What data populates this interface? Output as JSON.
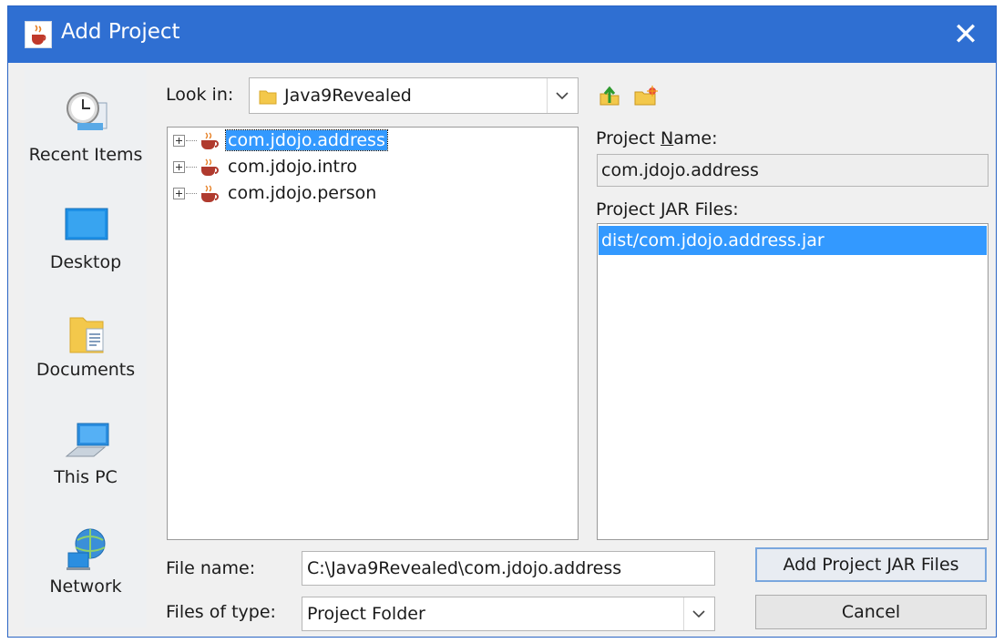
{
  "window": {
    "title": "Add Project",
    "close_glyph": "✕"
  },
  "places": [
    {
      "label": "Recent Items",
      "icon": "clock-icon"
    },
    {
      "label": "Desktop",
      "icon": "desktop-icon"
    },
    {
      "label": "Documents",
      "icon": "documents-folder-icon"
    },
    {
      "label": "This PC",
      "icon": "computer-icon"
    },
    {
      "label": "Network",
      "icon": "network-icon"
    }
  ],
  "look_in": {
    "label": "Look in:",
    "value": "Java9Revealed"
  },
  "toolbar": {
    "up_icon": "up-folder-icon",
    "new_folder_icon": "new-folder-icon"
  },
  "file_list": {
    "items": [
      {
        "name": "com.jdojo.address",
        "selected": true
      },
      {
        "name": "com.jdojo.intro",
        "selected": false
      },
      {
        "name": "com.jdojo.person",
        "selected": false
      }
    ]
  },
  "project_name": {
    "label_pre": "Project ",
    "label_mnemonic": "N",
    "label_post": "ame:",
    "value": "com.jdojo.address"
  },
  "project_jars": {
    "label_pre": "Project ",
    "label_mnemonic": "J",
    "label_post": "AR Files:",
    "items": [
      "dist/com.jdojo.address.jar"
    ]
  },
  "file_name": {
    "label": "File name:",
    "value": "C:\\Java9Revealed\\com.jdojo.address"
  },
  "files_of_type": {
    "label": "Files of type:",
    "value": "Project Folder"
  },
  "buttons": {
    "add_pre": "Add Pro",
    "add_mnemonic": "j",
    "add_post": "ect JAR Files",
    "cancel": "Cancel"
  },
  "colors": {
    "titlebar": "#2f6fd2",
    "selection": "#3399ff"
  }
}
